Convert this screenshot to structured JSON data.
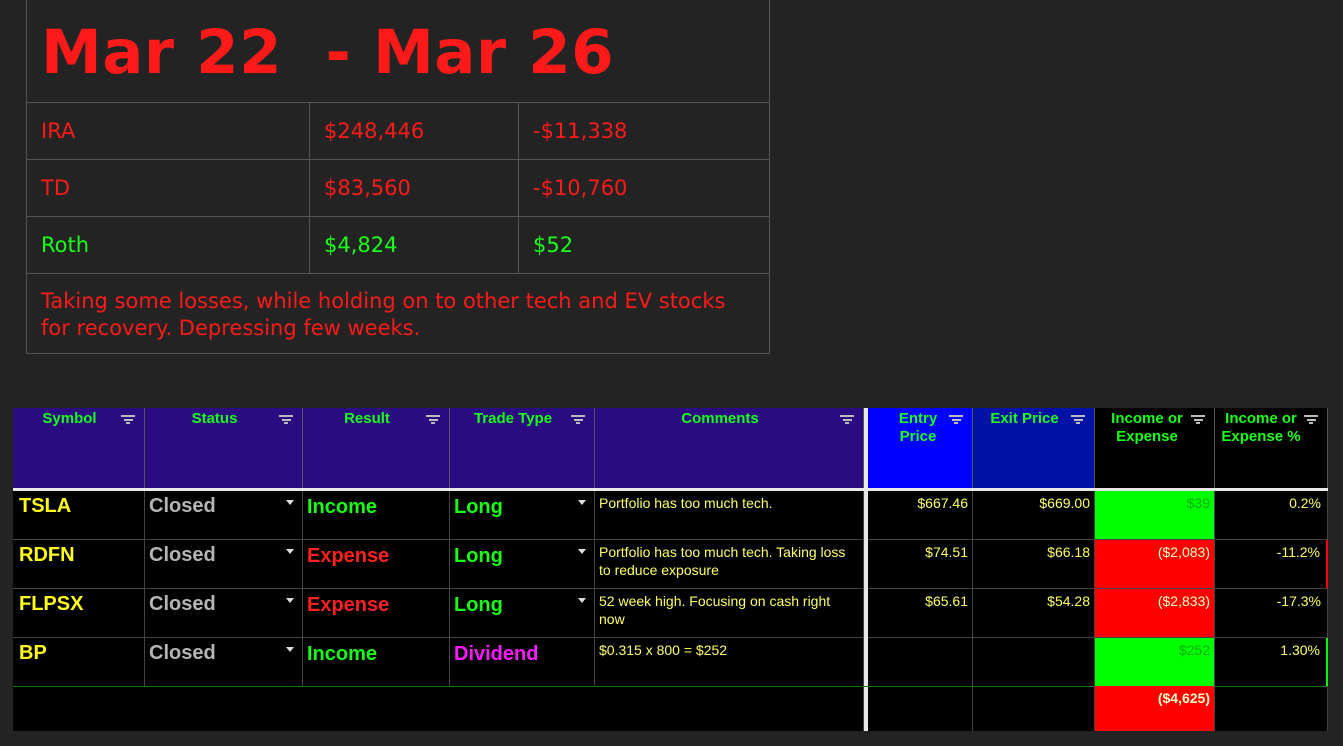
{
  "summary": {
    "title": "Mar 22  - Mar 26",
    "accounts": [
      {
        "name": "IRA",
        "balance": "$248,446",
        "change": "-$11,338",
        "tone": "red"
      },
      {
        "name": "TD",
        "balance": "$83,560",
        "change": "-$10,760",
        "tone": "red"
      },
      {
        "name": "Roth",
        "balance": "$4,824",
        "change": "$52",
        "tone": "green"
      }
    ],
    "note": "Taking some losses, while holding on to other tech and EV stocks for recovery. Depressing few weeks."
  },
  "sheet": {
    "headers": {
      "symbol": "Symbol",
      "status": "Status",
      "result": "Result",
      "trade_type": "Trade Type",
      "comments": "Comments",
      "entry_price": "Entry Price",
      "exit_price": "Exit Price",
      "income_or_expense": "Income or Expense",
      "income_or_expense_pct": "Income or Expense %"
    },
    "rows": [
      {
        "symbol": "TSLA",
        "status": "Closed",
        "result": "Income",
        "trade_type": "Long",
        "comment": "Portfolio has too much tech.",
        "entry": "$667.46",
        "exit": "$669.00",
        "amount": "$39",
        "pct": "0.2%"
      },
      {
        "symbol": "RDFN",
        "status": "Closed",
        "result": "Expense",
        "trade_type": "Long",
        "comment": "Portfolio has too much tech. Taking loss to reduce exposure",
        "entry": "$74.51",
        "exit": "$66.18",
        "amount": "($2,083)",
        "pct": "-11.2%"
      },
      {
        "symbol": "FLPSX",
        "status": "Closed",
        "result": "Expense",
        "trade_type": "Long",
        "comment": "52 week high. Focusing on cash right now",
        "entry": "$65.61",
        "exit": "$54.28",
        "amount": "($2,833)",
        "pct": "-17.3%"
      },
      {
        "symbol": "BP",
        "status": "Closed",
        "result": "Income",
        "trade_type": "Dividend",
        "comment": "$0.315 x 800 = $252",
        "entry": "",
        "exit": "",
        "amount": "$252",
        "pct": "1.30%"
      }
    ],
    "total": "($4,625)"
  },
  "colors": {
    "title_red": "#ff1a1a",
    "positive_green": "#1aff1a",
    "header_purple": "#2b0b80",
    "entry_blue": "#0000ff",
    "exit_blue": "#0011a6",
    "dividend_magenta": "#ff1aff"
  }
}
